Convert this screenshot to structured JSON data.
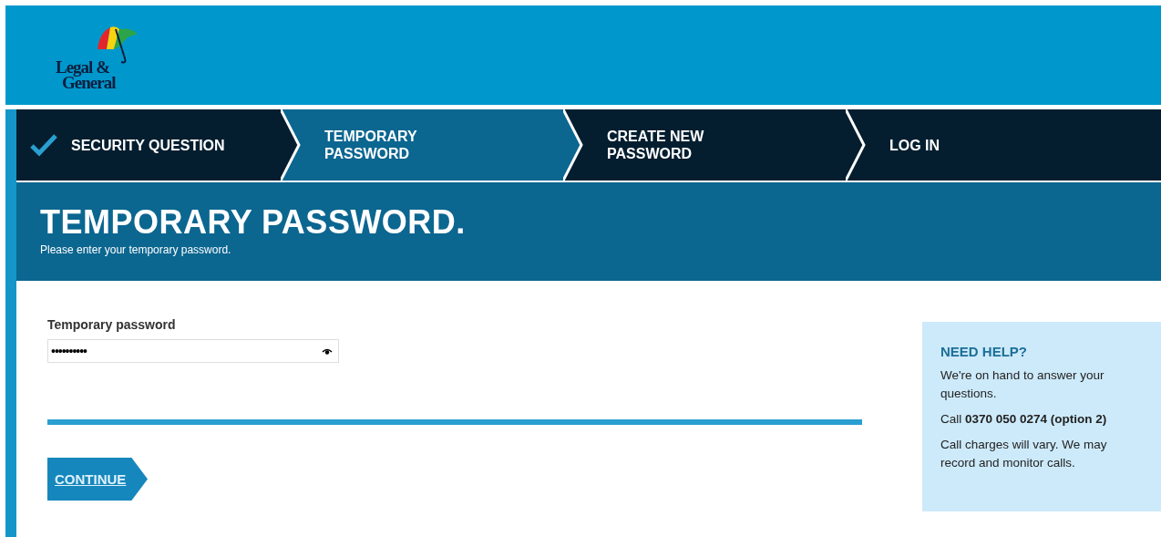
{
  "logo": {
    "line_1": "Legal &",
    "line_2": "General"
  },
  "steps": [
    {
      "label": "SECURITY QUESTION",
      "completed": true,
      "selected": false
    },
    {
      "label": "TEMPORARY PASSWORD",
      "completed": false,
      "selected": true
    },
    {
      "label": "CREATE NEW PASSWORD",
      "completed": false,
      "selected": false
    },
    {
      "label": "LOG IN",
      "completed": false,
      "selected": false
    }
  ],
  "page_title": "TEMPORARY PASSWORD.",
  "page_subtitle": "Please enter your temporary password.",
  "form": {
    "label": "Temporary password",
    "value": "••••••••••"
  },
  "continue_button": "CONTINUE",
  "help": {
    "title": "NEED HELP?",
    "paragraphs": [
      "We're on hand to answer your questions.",
      "Call **0370 050 0274 (option 2)**",
      "Call charges will vary. We may record and monitor calls."
    ]
  }
}
